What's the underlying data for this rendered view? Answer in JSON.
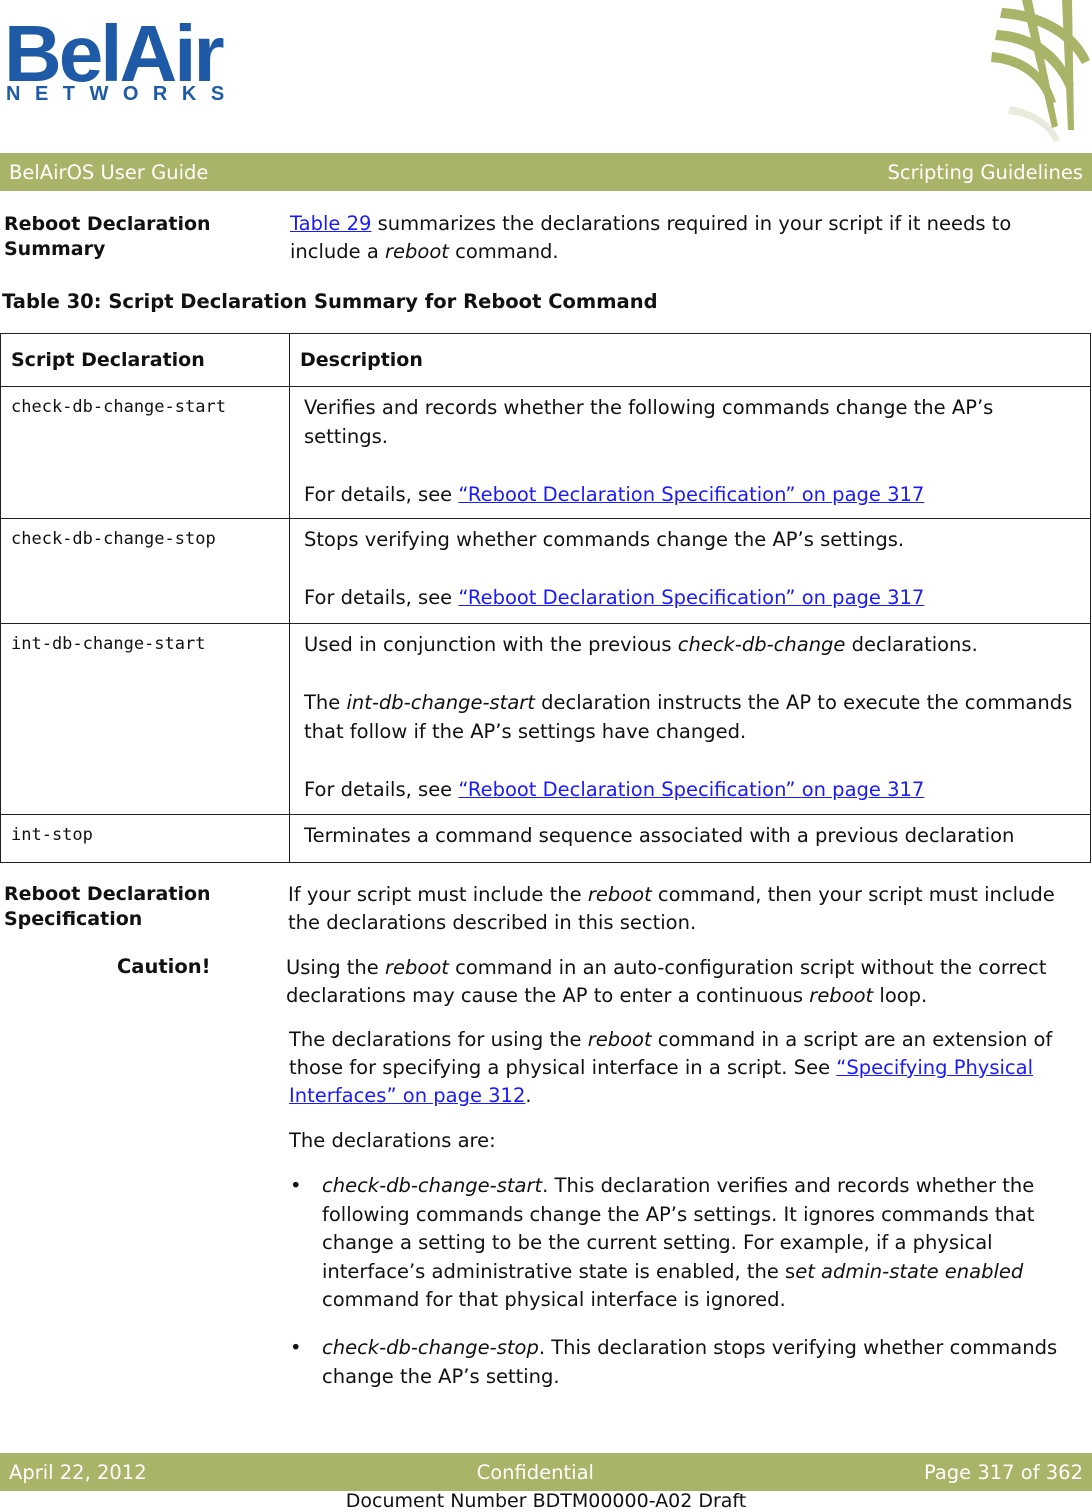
{
  "header": {
    "logo_main": "BelAir",
    "logo_sub": "NETWORKS",
    "left": "BelAirOS User Guide",
    "right": "Scripting Guidelines"
  },
  "summary_section": {
    "heading": "Reboot Declaration Summary",
    "link": "Table 29",
    "text_after_link": " summarizes the declarations required in your script if it needs to include a ",
    "italic": "reboot",
    "text_end": " command."
  },
  "table": {
    "caption": "Table 30: Script Declaration Summary for Reboot Command",
    "headers": [
      "Script Declaration",
      "Description"
    ],
    "rows": [
      {
        "declaration": "check-db-change-start",
        "desc1": "Verifies and records whether the following commands change the AP’s settings.",
        "details_prefix": "For details, see ",
        "details_link": "“Reboot Declaration Specification” on page 317"
      },
      {
        "declaration": "check-db-change-stop",
        "desc1": "Stops verifying whether commands change the AP’s settings.",
        "details_prefix": "For details, see ",
        "details_link": "“Reboot Declaration Specification” on page 317"
      },
      {
        "declaration": "int-db-change-start",
        "desc1_pre": "Used in conjunction with the previous ",
        "desc1_italic": "check-db-change",
        "desc1_post": " declarations.",
        "desc2_pre": "The ",
        "desc2_italic": "int-db-change-start",
        "desc2_post": " declaration instructs the AP to execute the commands that follow if the AP’s settings have changed.",
        "details_prefix": "For details, see ",
        "details_link": "“Reboot Declaration Specification” on page 317"
      },
      {
        "declaration": "int-stop",
        "desc1": "Terminates a command sequence associated with a previous declaration"
      }
    ]
  },
  "spec_section": {
    "heading": "Reboot Declaration Specification",
    "p1_pre": "If your script must include the ",
    "p1_italic": "reboot",
    "p1_post": " command, then your script must include the declarations described in this section.",
    "caution_label": "Caution!",
    "caution_pre": "Using the ",
    "caution_italic1": "reboot",
    "caution_mid": " command in an auto-configuration script without the correct declarations may cause the AP to enter a continuous ",
    "caution_italic2": "reboot",
    "caution_post": " loop.",
    "p2_pre": "The declarations for using the ",
    "p2_italic": "reboot",
    "p2_mid": " command in a script are an extension of those for specifying a physical interface in a script. See ",
    "p2_link": "“Specifying Physical Interfaces” on page 312",
    "p2_post": ".",
    "p3": "The declarations are:",
    "bullets": [
      {
        "italic": "check-db-change-start",
        "text_pre": ". This declaration verifies and records whether the following commands change the AP’s settings. It ignores commands that change a setting to be the current setting. For example, if a physical interface’s administrative state is enabled, the s",
        "italic2": "et admin-state enabled",
        "text_post": " command for that physical interface is ignored."
      },
      {
        "italic": "check-db-change-stop",
        "text_pre": ". This declaration stops verifying whether commands change the AP’s setting."
      }
    ],
    "bullet_glyph": "•"
  },
  "footer": {
    "date": "April 22, 2012",
    "center": "Confidential",
    "page": "Page 317 of 362",
    "doc_number": "Document Number BDTM00000-A02 Draft"
  }
}
